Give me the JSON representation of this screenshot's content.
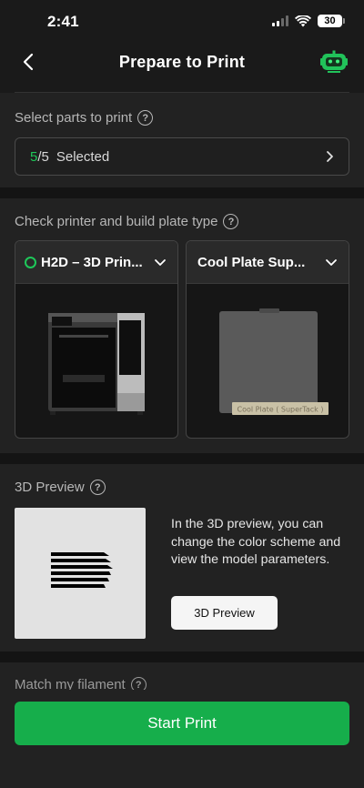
{
  "status_bar": {
    "time": "2:41",
    "battery": "30"
  },
  "nav": {
    "title": "Prepare to Print"
  },
  "parts": {
    "label": "Select parts to print",
    "selected": "5",
    "separator": "/",
    "total": "5",
    "suffix": "Selected"
  },
  "printer_section": {
    "label": "Check printer and build plate type",
    "printer": {
      "name": "H2D – 3D Prin..."
    },
    "plate": {
      "name": "Cool Plate Sup...",
      "image_label": "Cool Plate ( SuperTack )"
    }
  },
  "preview_section": {
    "label": "3D Preview",
    "description": "In the 3D preview, you can change the color scheme and view the model parameters.",
    "button_label": "3D Preview"
  },
  "filament_section": {
    "label": "Match my filament"
  },
  "footer": {
    "start_label": "Start Print"
  },
  "colors": {
    "accent": "#16ae4b",
    "status_green": "#1ec759",
    "background": "#1a1a1a",
    "card": "#222222"
  },
  "icons": {
    "back": "chevron-left-icon",
    "assistant": "robot-icon",
    "help": "question-circle-icon",
    "chevron_right": "chevron-right-icon",
    "chevron_down": "chevron-down-icon"
  }
}
